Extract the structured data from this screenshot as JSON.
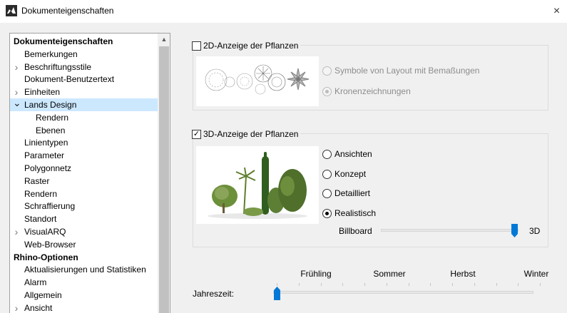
{
  "window": {
    "title": "Dokumenteigenschaften",
    "close_icon": "×"
  },
  "tree": {
    "items": [
      {
        "label": "Dokumenteigenschaften",
        "level": 0,
        "bold": true,
        "expander": "",
        "selected": false
      },
      {
        "label": "Bemerkungen",
        "level": 1,
        "bold": false,
        "expander": "",
        "selected": false
      },
      {
        "label": "Beschriftungsstile",
        "level": 1,
        "bold": false,
        "expander": "collapsed",
        "selected": false
      },
      {
        "label": "Dokument-Benutzertext",
        "level": 1,
        "bold": false,
        "expander": "",
        "selected": false
      },
      {
        "label": "Einheiten",
        "level": 1,
        "bold": false,
        "expander": "collapsed",
        "selected": false
      },
      {
        "label": "Lands Design",
        "level": 1,
        "bold": false,
        "expander": "expanded",
        "selected": true
      },
      {
        "label": "Rendern",
        "level": 2,
        "bold": false,
        "expander": "",
        "selected": false
      },
      {
        "label": "Ebenen",
        "level": 2,
        "bold": false,
        "expander": "",
        "selected": false
      },
      {
        "label": "Linientypen",
        "level": 1,
        "bold": false,
        "expander": "",
        "selected": false
      },
      {
        "label": "Parameter",
        "level": 1,
        "bold": false,
        "expander": "",
        "selected": false
      },
      {
        "label": "Polygonnetz",
        "level": 1,
        "bold": false,
        "expander": "",
        "selected": false
      },
      {
        "label": "Raster",
        "level": 1,
        "bold": false,
        "expander": "",
        "selected": false
      },
      {
        "label": "Rendern",
        "level": 1,
        "bold": false,
        "expander": "",
        "selected": false
      },
      {
        "label": "Schraffierung",
        "level": 1,
        "bold": false,
        "expander": "",
        "selected": false
      },
      {
        "label": "Standort",
        "level": 1,
        "bold": false,
        "expander": "",
        "selected": false
      },
      {
        "label": "VisualARQ",
        "level": 1,
        "bold": false,
        "expander": "collapsed",
        "selected": false
      },
      {
        "label": "Web-Browser",
        "level": 1,
        "bold": false,
        "expander": "",
        "selected": false
      },
      {
        "label": "Rhino-Optionen",
        "level": 0,
        "bold": true,
        "expander": "",
        "selected": false
      },
      {
        "label": "Aktualisierungen und Statistiken",
        "level": 1,
        "bold": false,
        "expander": "",
        "selected": false
      },
      {
        "label": "Alarm",
        "level": 1,
        "bold": false,
        "expander": "",
        "selected": false
      },
      {
        "label": "Allgemein",
        "level": 1,
        "bold": false,
        "expander": "",
        "selected": false
      },
      {
        "label": "Ansicht",
        "level": 1,
        "bold": false,
        "expander": "collapsed",
        "selected": false
      }
    ]
  },
  "display2d": {
    "checkbox_label": "2D-Anzeige der Pflanzen",
    "checked": false,
    "options": [
      {
        "label": "Symbole von Layout mit Bemaßungen",
        "checked": false
      },
      {
        "label": "Kronenzeichnungen",
        "checked": true
      }
    ],
    "enabled": false
  },
  "display3d": {
    "checkbox_label": "3D-Anzeige der Pflanzen",
    "checked": true,
    "check_glyph": "✓",
    "options": [
      {
        "label": "Ansichten",
        "checked": false
      },
      {
        "label": "Konzept",
        "checked": false
      },
      {
        "label": "Detailliert",
        "checked": false
      },
      {
        "label": "Realistisch",
        "checked": true
      }
    ],
    "billboard_slider": {
      "min_label": "Billboard",
      "max_label": "3D",
      "value_fraction": 1.0
    }
  },
  "season": {
    "label": "Jahreszeit:",
    "ticks": [
      "Frühling",
      "Sommer",
      "Herbst",
      "Winter"
    ],
    "selected": "Frühling"
  },
  "colors": {
    "accent": "#0078d7",
    "selection": "#cce8ff"
  }
}
